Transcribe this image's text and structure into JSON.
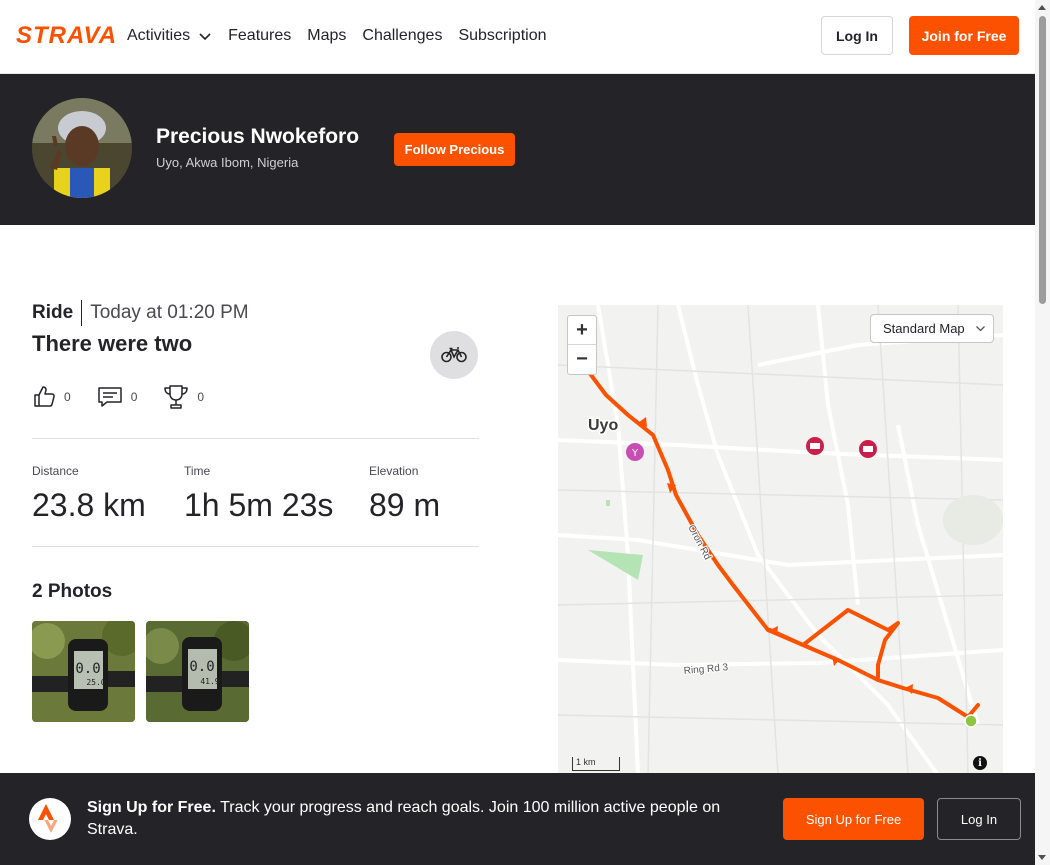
{
  "nav": {
    "logo": "STRAVA",
    "links": [
      "Activities",
      "Features",
      "Maps",
      "Challenges",
      "Subscription"
    ],
    "login_label": "Log In",
    "join_label": "Join for Free"
  },
  "athlete": {
    "name": "Precious Nwokeforo",
    "location": "Uyo, Akwa Ibom, Nigeria",
    "follow_label": "Follow Precious"
  },
  "activity": {
    "type": "Ride",
    "date": "Today at 01:20 PM",
    "title": "There were two",
    "sport_icon": "bike-icon",
    "kudos": "0",
    "comments": "0",
    "achievements": "0",
    "stats": [
      {
        "label": "Distance",
        "value": "23.8 km"
      },
      {
        "label": "Time",
        "value": "1h 5m 23s"
      },
      {
        "label": "Elevation",
        "value": "89 m"
      }
    ],
    "photos_title": "2 Photos",
    "photo_readings": [
      "25.0",
      "41.9"
    ]
  },
  "map": {
    "style_label": "Standard Map",
    "zoom_in": "+",
    "zoom_out": "−",
    "city_label": "Uyo",
    "road_labels": [
      "Oron Rd",
      "Ring Rd 3"
    ],
    "scale_label": "1 km",
    "info": "i",
    "route_color": "#fc5200",
    "start_color": "#8dc63f"
  },
  "cta": {
    "headline": "Sign Up for Free.",
    "body": "Track your progress and reach goals. Join 100 million active people on Strava.",
    "signup_label": "Sign Up for Free",
    "login_label": "Log In"
  },
  "colors": {
    "brand": "#fc5200",
    "dark": "#242428"
  }
}
